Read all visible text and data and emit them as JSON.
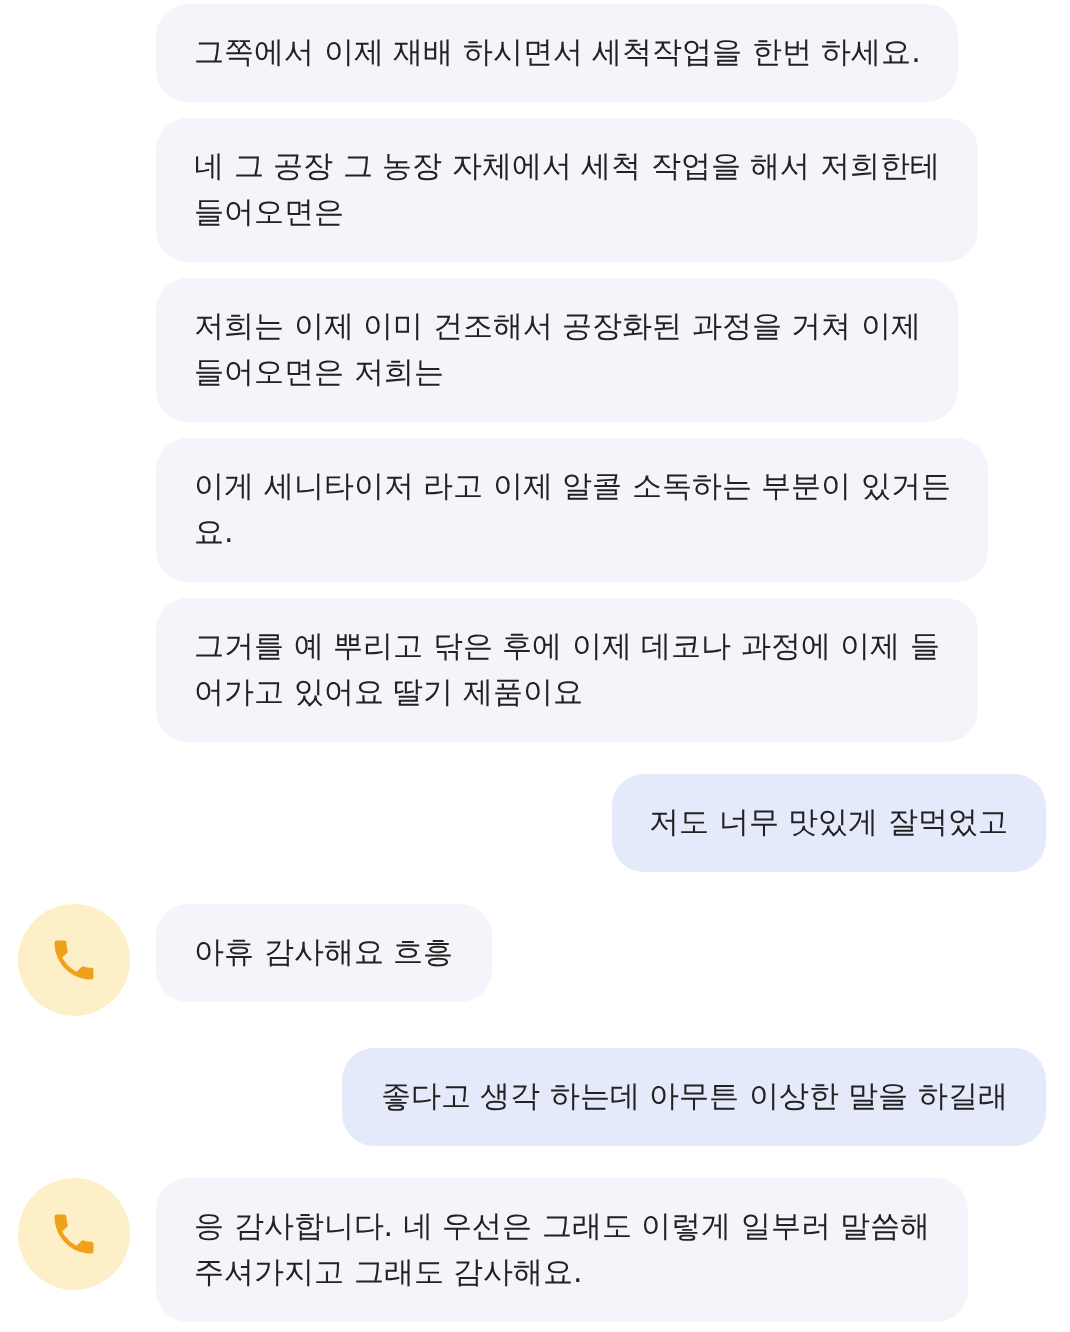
{
  "messages": [
    {
      "kind": "received",
      "avatar": false,
      "lines": [
        "그쪽에서 이제 재배 하시면서 세척작업을 한번 하세요."
      ]
    },
    {
      "kind": "received",
      "avatar": false,
      "lines": [
        "네 그 공장 그 농장 자체에서 세척 작업을 해서 저희한테",
        "들어오면은"
      ]
    },
    {
      "kind": "received",
      "avatar": false,
      "lines": [
        "저희는 이제 이미 건조해서 공장화된 과정을 거쳐 이제",
        "들어오면은 저희는"
      ]
    },
    {
      "kind": "received",
      "avatar": false,
      "lines": [
        "이게 세니타이저 라고 이제 알콜 소독하는 부분이 있거든",
        "요."
      ]
    },
    {
      "kind": "received",
      "avatar": false,
      "lines": [
        "그거를 예 뿌리고 닦은 후에 이제 데코나 과정에 이제 들",
        "어가고 있어요 딸기 제품이요"
      ]
    },
    {
      "kind": "sent",
      "avatar": false,
      "lines": [
        "저도 너무 맛있게 잘먹었고"
      ]
    },
    {
      "kind": "received",
      "avatar": true,
      "lines": [
        "아휴 감사해요 흐흥"
      ]
    },
    {
      "kind": "sent",
      "avatar": false,
      "lines": [
        "좋다고 생각 하는데 아무튼 이상한 말을 하길래"
      ]
    },
    {
      "kind": "received",
      "avatar": true,
      "lines": [
        "응 감사합니다. 네 우선은 그래도 이렇게 일부러 말씀해",
        "주셔가지고 그래도 감사해요."
      ]
    }
  ]
}
